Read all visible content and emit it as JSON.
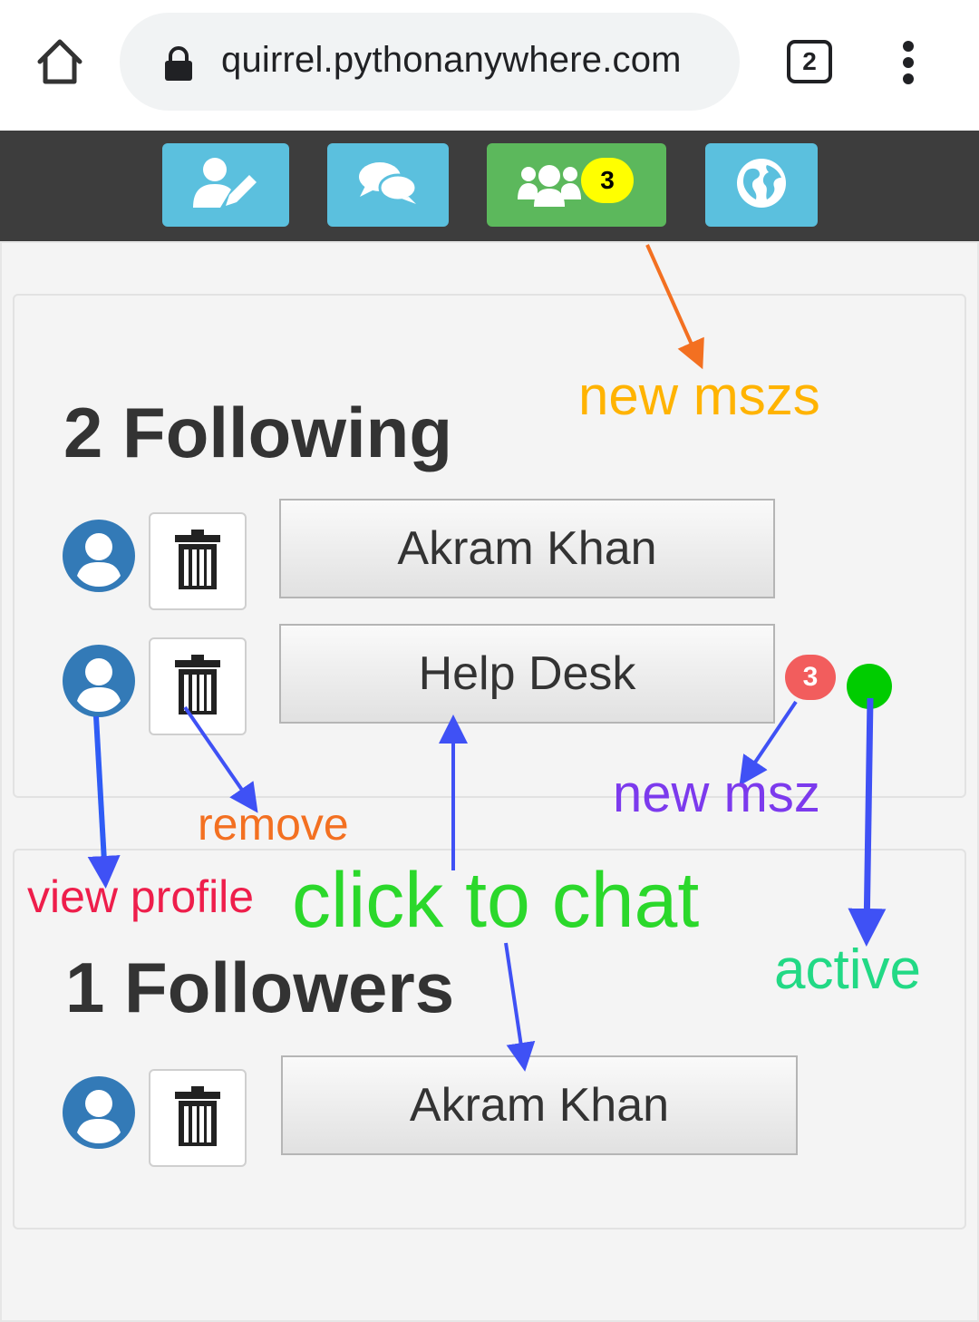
{
  "browser": {
    "url": "quirrel.pythonanywhere.com",
    "tab_count": "2",
    "icons": [
      "home-icon",
      "lock-icon",
      "tab-switcher-icon",
      "more-vert-icon"
    ]
  },
  "navbar": {
    "buttons": [
      {
        "name": "edit-profile",
        "icon": "user-edit-icon",
        "color": "#5bc0de"
      },
      {
        "name": "chats",
        "icon": "comments-icon",
        "color": "#5bc0de"
      },
      {
        "name": "friends",
        "icon": "users-icon",
        "color": "#5cb85c",
        "badge": "3"
      },
      {
        "name": "explore",
        "icon": "globe-icon",
        "color": "#5bc0de"
      }
    ]
  },
  "following": {
    "heading": "2 Following",
    "users": [
      {
        "name": "Akram Khan"
      },
      {
        "name": "Help Desk",
        "new_messages": "3",
        "active": true
      }
    ]
  },
  "followers": {
    "heading": "1 Followers",
    "users": [
      {
        "name": "Akram Khan"
      }
    ]
  },
  "annotations": {
    "new_mszs": {
      "text": "new mszs",
      "color": "#ffb300"
    },
    "new_msz": {
      "text": "new msz",
      "color": "#7c3aed"
    },
    "remove": {
      "text": "remove",
      "color": "#f37021"
    },
    "view_profile": {
      "text": "view profile",
      "color": "#ee1e4b"
    },
    "click_to_chat": {
      "text": "click to chat",
      "color": "#2bd82b"
    },
    "active": {
      "text": "active",
      "color": "#22d985"
    }
  }
}
